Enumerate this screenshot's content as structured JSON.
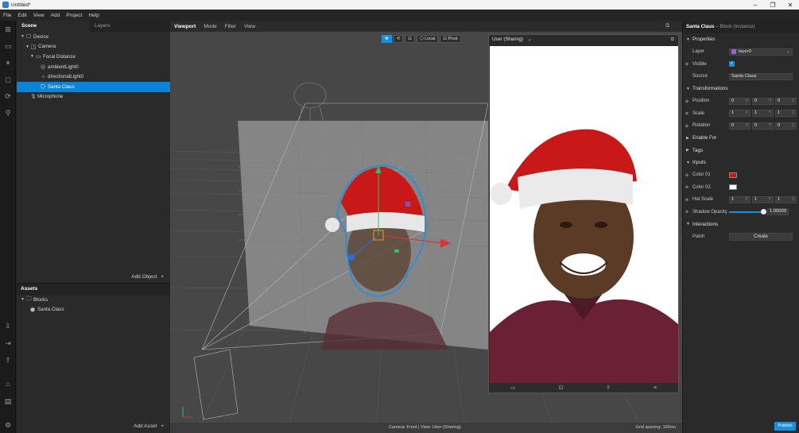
{
  "window": {
    "title": "Untitled*",
    "minimize": "–",
    "maximize": "❐",
    "close": "✕"
  },
  "menu": [
    "File",
    "Edit",
    "View",
    "Add",
    "Project",
    "Help"
  ],
  "scene": {
    "tab_scene": "Scene",
    "tab_layers": "Layers",
    "tree": [
      {
        "label": "Device",
        "icon": "☐",
        "arrow": "▼"
      },
      {
        "label": "Camera",
        "icon": "◫",
        "arrow": "▼"
      },
      {
        "label": "Focal Distance",
        "icon": "▭",
        "arrow": "▼"
      },
      {
        "label": "ambientLight0",
        "icon": "◎",
        "arrow": ""
      },
      {
        "label": "directionalLight0",
        "icon": "☼",
        "arrow": ""
      },
      {
        "label": "Santa Claus",
        "icon": "⬡",
        "arrow": ""
      },
      {
        "label": "Microphone",
        "icon": "🎙",
        "arrow": ""
      }
    ],
    "add_object": "Add Object",
    "plus": "+"
  },
  "assets": {
    "header": "Assets",
    "items": [
      {
        "label": "Blocks",
        "icon": "🗀",
        "arrow": "▼"
      },
      {
        "label": "Santa Claus",
        "icon": "⬢",
        "arrow": ""
      }
    ],
    "add_asset": "Add Asset",
    "plus": "+"
  },
  "viewport": {
    "tabs": [
      "Viewport",
      "Mode",
      "Filter",
      "View"
    ],
    "tools": [
      "✥",
      "⟲",
      "⊡",
      "⬡ Local",
      "⊡ Pivot"
    ],
    "camera_status": "Camera: Front | View: User (Sharing)",
    "grid_status": "Grid spacing: 100cm"
  },
  "simulator": {
    "device": "User (Sharing)",
    "chevron": "⌄",
    "footer_icons": [
      "▭",
      "⊡",
      "⇪",
      "≡"
    ]
  },
  "inspector": {
    "title": "Santa Claus",
    "subtitle": "– Block (Instance)",
    "sections": {
      "properties": "Properties",
      "transformations": "Transformations",
      "enable_for": "Enable For",
      "tags": "Tags",
      "inputs": "Inputs",
      "interactions": "Interactions"
    },
    "layer_label": "Layer",
    "layer_value": "layer0",
    "visible_label": "Visible",
    "check": "✓",
    "source_label": "Source",
    "source_value": "Santa Claus",
    "position_label": "Position",
    "position": [
      "0",
      "0",
      "0"
    ],
    "scale_label": "Scale",
    "scale": [
      "1",
      "1",
      "1"
    ],
    "rotation_label": "Rotation",
    "rotation": [
      "0",
      "0",
      "0"
    ],
    "axis_labels": [
      "X",
      "Y",
      "Z"
    ],
    "color01_label": "Color 01",
    "color01": "#e01010",
    "color02_label": "Color 02",
    "color02": "#ffffff",
    "hatscale_label": "Hat Scale",
    "hatscale": [
      "1",
      "1",
      "1"
    ],
    "shadow_label": "Shadow Opacity",
    "shadow_value": "1.00000",
    "shadow_level": 1.0,
    "patch_label": "Patch",
    "create_label": "Create",
    "publish": "Publish"
  }
}
